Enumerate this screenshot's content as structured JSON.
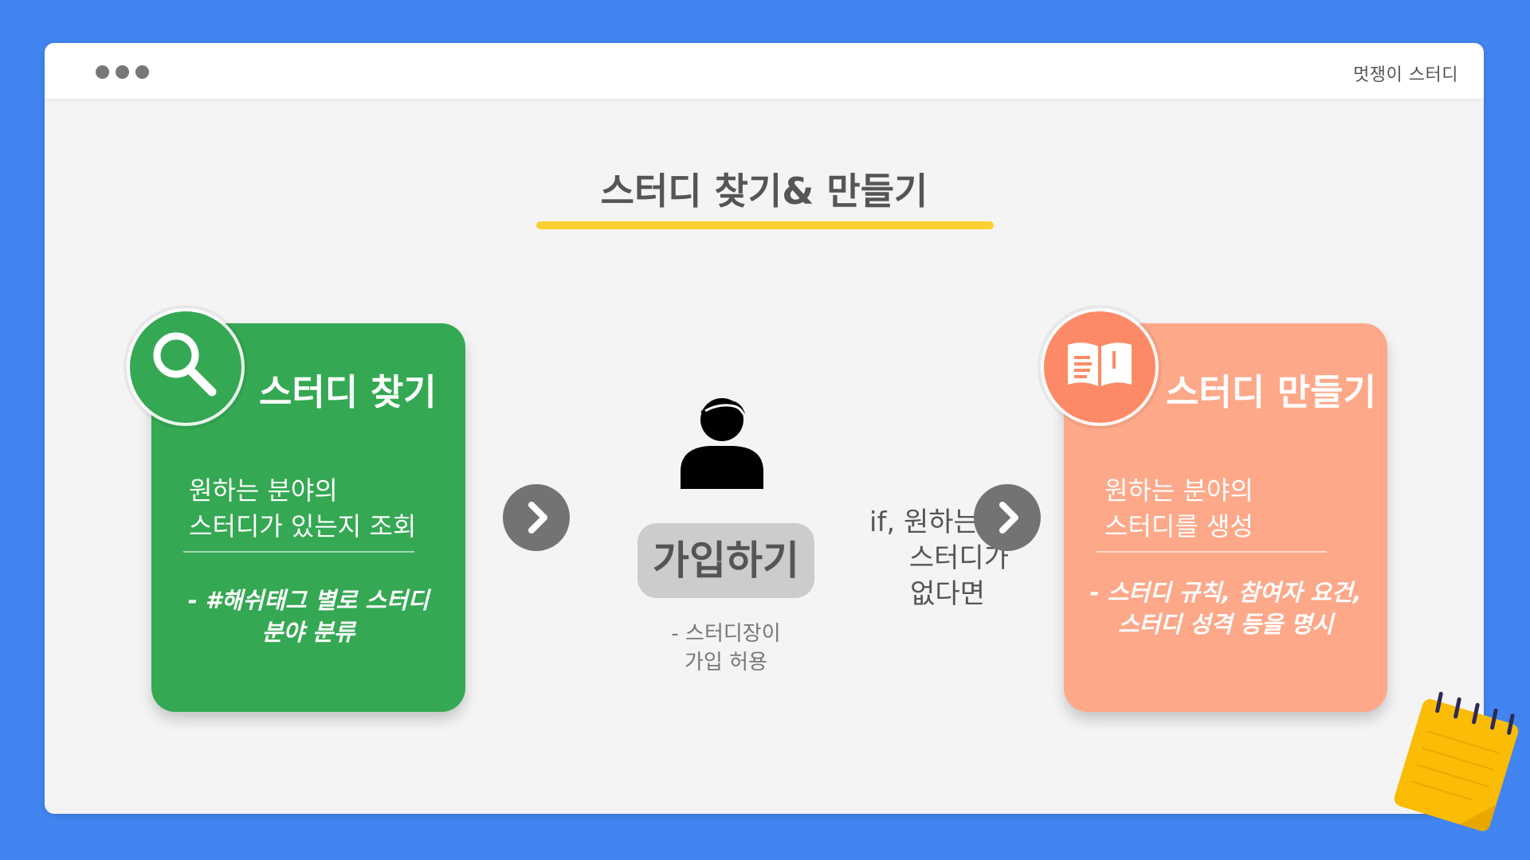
{
  "window": {
    "title": "멋쟁이 스터디"
  },
  "page": {
    "title": "스터디 찾기& 만들기"
  },
  "find_card": {
    "icon": "search-icon",
    "heading": "스터디 찾기",
    "desc_lines": [
      "원하는 분야의",
      "스터디가 있는지 조회"
    ],
    "note_lines": [
      "- #해쉬태그 별로 스터디",
      "분야 분류"
    ]
  },
  "join": {
    "icon": "person-icon",
    "label": "가입하기",
    "note_lines": [
      "- 스터디장이",
      "가입 허용"
    ]
  },
  "condition": {
    "lines": [
      "if, 원하는",
      "스터디가",
      "없다면"
    ]
  },
  "create_card": {
    "icon": "open-book-icon",
    "heading": "스터디 만들기",
    "desc_lines": [
      "원하는 분야의",
      "스터디를 생성"
    ],
    "note_lines": [
      "- 스터디 규칙, 참여자 요건,",
      "스터디 성격 등을 명시"
    ]
  },
  "colors": {
    "background": "#4285f0",
    "find_card": "#34a853",
    "create_card": "#fea88a",
    "create_badge": "#fd8a66",
    "title_underline": "#fcd031",
    "arrow": "#737373",
    "notepad": "#fbbc05"
  }
}
